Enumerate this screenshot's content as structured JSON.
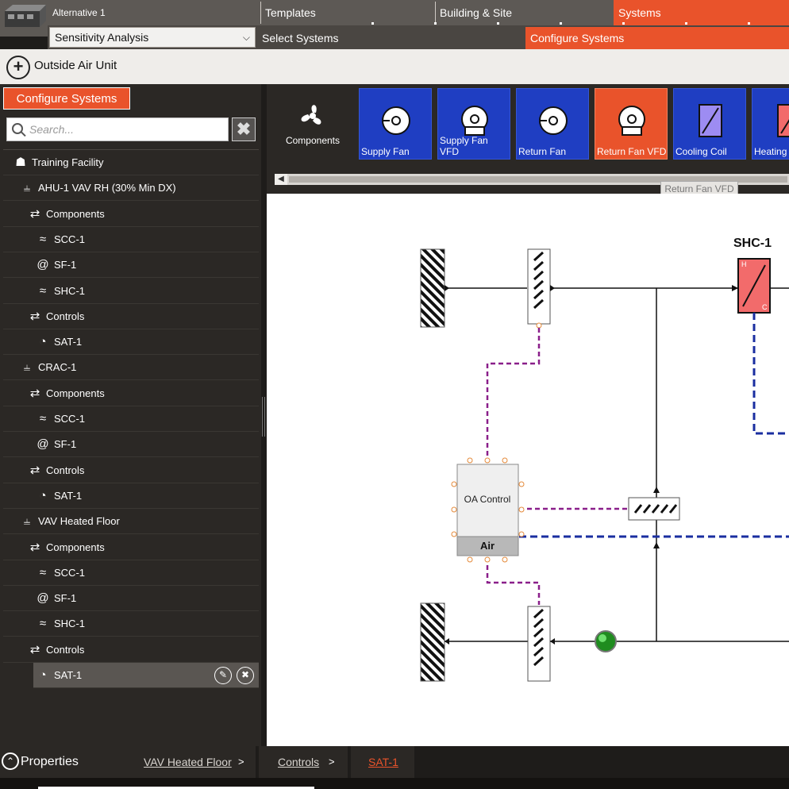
{
  "header": {
    "alternative": "Alternative 1",
    "tabs": [
      "Templates",
      "Building & Site",
      "Systems"
    ],
    "active_tab": "Systems",
    "dropdown_value": "Sensitivity Analysis",
    "stages": [
      "Select Systems",
      "Configure Systems"
    ],
    "active_stage": "Configure Systems"
  },
  "toolbar": {
    "title": "Outside Air Unit",
    "add_icon": "plus-circle-icon"
  },
  "left_panel": {
    "title": "Configure Systems",
    "search_placeholder": "Search...",
    "tree": [
      {
        "label": "Training Facility",
        "icon": "building-icon",
        "level": 0
      },
      {
        "label": "AHU-1 VAV RH (30% Min DX)",
        "icon": "system-tree-icon",
        "level": 1
      },
      {
        "label": "Components",
        "icon": "components-icon",
        "level": 2
      },
      {
        "label": "SCC-1",
        "icon": "coil-icon",
        "level": 3
      },
      {
        "label": "SF-1",
        "icon": "fan-icon",
        "level": 3
      },
      {
        "label": "SHC-1",
        "icon": "coil-icon",
        "level": 3
      },
      {
        "label": "Controls",
        "icon": "controls-icon",
        "level": 2
      },
      {
        "label": "SAT-1",
        "icon": "gauge-icon",
        "level": 3
      },
      {
        "label": "CRAC-1",
        "icon": "system-tree-icon",
        "level": 1
      },
      {
        "label": "Components",
        "icon": "components-icon",
        "level": 2
      },
      {
        "label": "SCC-1",
        "icon": "coil-icon",
        "level": 3
      },
      {
        "label": "SF-1",
        "icon": "fan-icon",
        "level": 3
      },
      {
        "label": "Controls",
        "icon": "controls-icon",
        "level": 2
      },
      {
        "label": "SAT-1",
        "icon": "gauge-icon",
        "level": 3
      },
      {
        "label": "VAV Heated Floor",
        "icon": "system-tree-icon",
        "level": 1
      },
      {
        "label": "Components",
        "icon": "components-icon",
        "level": 2
      },
      {
        "label": "SCC-1",
        "icon": "coil-icon",
        "level": 3
      },
      {
        "label": "SF-1",
        "icon": "fan-icon",
        "level": 3
      },
      {
        "label": "SHC-1",
        "icon": "coil-icon",
        "level": 3
      },
      {
        "label": "Controls",
        "icon": "controls-icon",
        "level": 2
      },
      {
        "label": "SAT-1",
        "icon": "gauge-icon",
        "level": 3,
        "selected": true
      }
    ]
  },
  "palette": {
    "components_label": "Components",
    "items": [
      {
        "label": "Supply Fan",
        "icon": "fan-icon"
      },
      {
        "label": "Supply Fan VFD",
        "icon": "fan-vfd-icon"
      },
      {
        "label": "Return Fan",
        "icon": "fan-icon"
      },
      {
        "label": "Return Fan VFD",
        "icon": "fan-vfd-icon",
        "active": true
      },
      {
        "label": "Cooling Coil",
        "icon": "cooling-coil-icon"
      },
      {
        "label": "Heating",
        "icon": "heating-coil-icon"
      }
    ],
    "tooltip": "Return Fan VFD"
  },
  "diagram": {
    "coil_title": "SHC-1",
    "coil_h": "H",
    "coil_c": "C",
    "oa_control_label": "OA Control",
    "oa_control_sub": "Air"
  },
  "footer": {
    "properties_label": "Properties",
    "breadcrumb": [
      "VAV Heated Floor",
      "Controls",
      "SAT-1"
    ],
    "separator": ">"
  },
  "colors": {
    "accent": "#e9532b",
    "tile_blue": "#1f3ec2",
    "panel_dark": "#2b2825",
    "header_gray": "#5d5955"
  }
}
